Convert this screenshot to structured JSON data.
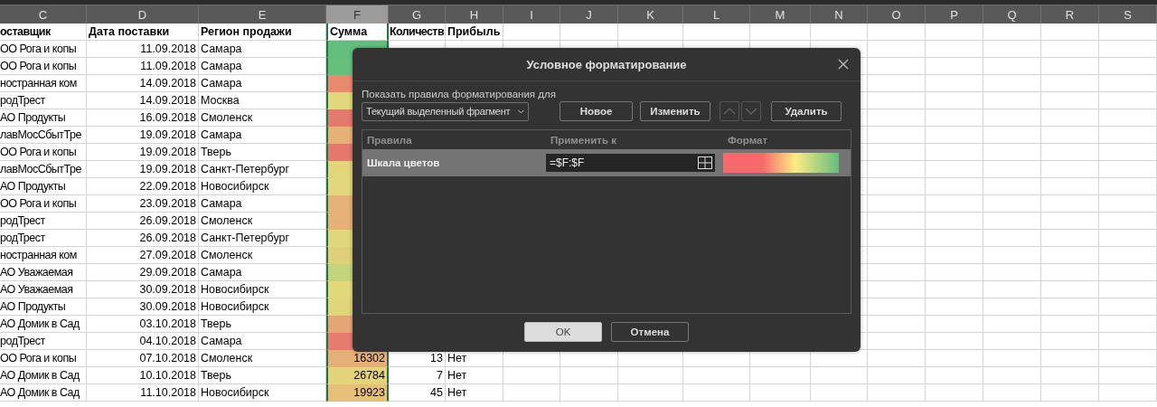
{
  "sheet": {
    "columns": [
      {
        "label": "C",
        "selected": false
      },
      {
        "label": "D",
        "selected": false
      },
      {
        "label": "E",
        "selected": false
      },
      {
        "label": "F",
        "selected": true
      },
      {
        "label": "G",
        "selected": false
      },
      {
        "label": "H",
        "selected": false
      },
      {
        "label": "I",
        "selected": false
      },
      {
        "label": "J",
        "selected": false
      },
      {
        "label": "K",
        "selected": false
      },
      {
        "label": "L",
        "selected": false
      },
      {
        "label": "M",
        "selected": false
      },
      {
        "label": "N",
        "selected": false
      },
      {
        "label": "O",
        "selected": false
      },
      {
        "label": "P",
        "selected": false
      },
      {
        "label": "Q",
        "selected": false
      },
      {
        "label": "R",
        "selected": false
      },
      {
        "label": "S",
        "selected": false
      }
    ],
    "header": {
      "supplier": "оставщик",
      "date": "Дата поставки",
      "region": "Регион продажи",
      "sum": "Сумма",
      "qty": "Количеств",
      "profit": "Прибыль"
    },
    "rows": [
      {
        "supplier": "ОО Рога и копы",
        "date": "11.09.2018",
        "region": "Самара",
        "color": "#63be7b"
      },
      {
        "supplier": "ОО Рога и копы",
        "date": "11.09.2018",
        "region": "Самара",
        "color": "#66bf7b"
      },
      {
        "supplier": "ностранная ком",
        "date": "14.09.2018",
        "region": "Самара",
        "color": "#e9896f"
      },
      {
        "supplier": "родТрест",
        "date": "14.09.2018",
        "region": "Москва",
        "color": "#e0d87a"
      },
      {
        "supplier": "АО Продукты",
        "date": "16.09.2018",
        "region": "Смоленск",
        "color": "#e5796d"
      },
      {
        "supplier": "лавМосСбытТре",
        "date": "19.09.2018",
        "region": "Самара",
        "color": "#e6b177"
      },
      {
        "supplier": "ОО Рога и копы",
        "date": "19.09.2018",
        "region": "Тверь",
        "color": "#e5786d"
      },
      {
        "supplier": "лавМосСбытТре",
        "date": "19.09.2018",
        "region": "Санкт-Петербург",
        "color": "#e0d67a"
      },
      {
        "supplier": "АО Продукты",
        "date": "22.09.2018",
        "region": "Новосибирск",
        "color": "#e0d87a"
      },
      {
        "supplier": "ОО Рога и копы",
        "date": "23.09.2018",
        "region": "Самара",
        "color": "#e5b277"
      },
      {
        "supplier": "родТрест",
        "date": "26.09.2018",
        "region": "Смоленск",
        "color": "#e6b177"
      },
      {
        "supplier": "родТрест",
        "date": "26.09.2018",
        "region": "Санкт-Петербург",
        "color": "#dfd77a"
      },
      {
        "supplier": "ностранная ком",
        "date": "27.09.2018",
        "region": "Смоленск",
        "color": "#e1ce79"
      },
      {
        "supplier": "АО Уважаемая",
        "date": "29.09.2018",
        "region": "Самара",
        "color": "#c5d47c"
      },
      {
        "supplier": "АО Уважаемая",
        "date": "30.09.2018",
        "region": "Новосибирск",
        "color": "#e2d87a"
      },
      {
        "supplier": "АО Продукты",
        "date": "30.09.2018",
        "region": "Новосибирск",
        "color": "#e0d57a"
      },
      {
        "supplier": "АО Домик в Сад",
        "date": "03.10.2018",
        "region": "Тверь",
        "color": "#e6a574"
      },
      {
        "supplier": "родТрест",
        "date": "04.10.2018",
        "region": "Самара",
        "color": "#e67c6e"
      },
      {
        "supplier": "ОО Рога и копы",
        "date": "07.10.2018",
        "region": "Смоленск",
        "sum": "16302",
        "color": "#e5b077",
        "qty": "13",
        "profit": "Нет"
      },
      {
        "supplier": "АО Домик в Сад",
        "date": "10.10.2018",
        "region": "Тверь",
        "sum": "26784",
        "color": "#e3d37a",
        "qty": "7",
        "profit": "Нет"
      },
      {
        "supplier": "АО Домик в Сад",
        "date": "11.10.2018",
        "region": "Новосибирск",
        "sum": "19923",
        "color": "#e6c077",
        "qty": "45",
        "profit": "Нет"
      }
    ]
  },
  "dialog": {
    "title": "Условное форматирование",
    "scope_label": "Показать правила форматирования для",
    "scope": "Текущий выделенный фрагмент",
    "toolbar": [
      {
        "kind": "button",
        "label": "Новое"
      },
      {
        "kind": "button",
        "label": "Изменить"
      },
      {
        "kind": "move_up",
        "disabled": true
      },
      {
        "kind": "move_down",
        "disabled": true
      },
      {
        "kind": "button",
        "label": "Удалить"
      }
    ],
    "columns": [
      "Правила",
      "Применить к",
      "Формат"
    ],
    "rules": [
      {
        "name": "Шкала цветов",
        "applies_to": "=$F:$F",
        "selected": true,
        "kind": "color_scale"
      }
    ],
    "buttons": [
      {
        "label": "OK",
        "kind": "primary"
      },
      {
        "label": "Отмена",
        "kind": "secondary"
      }
    ]
  }
}
